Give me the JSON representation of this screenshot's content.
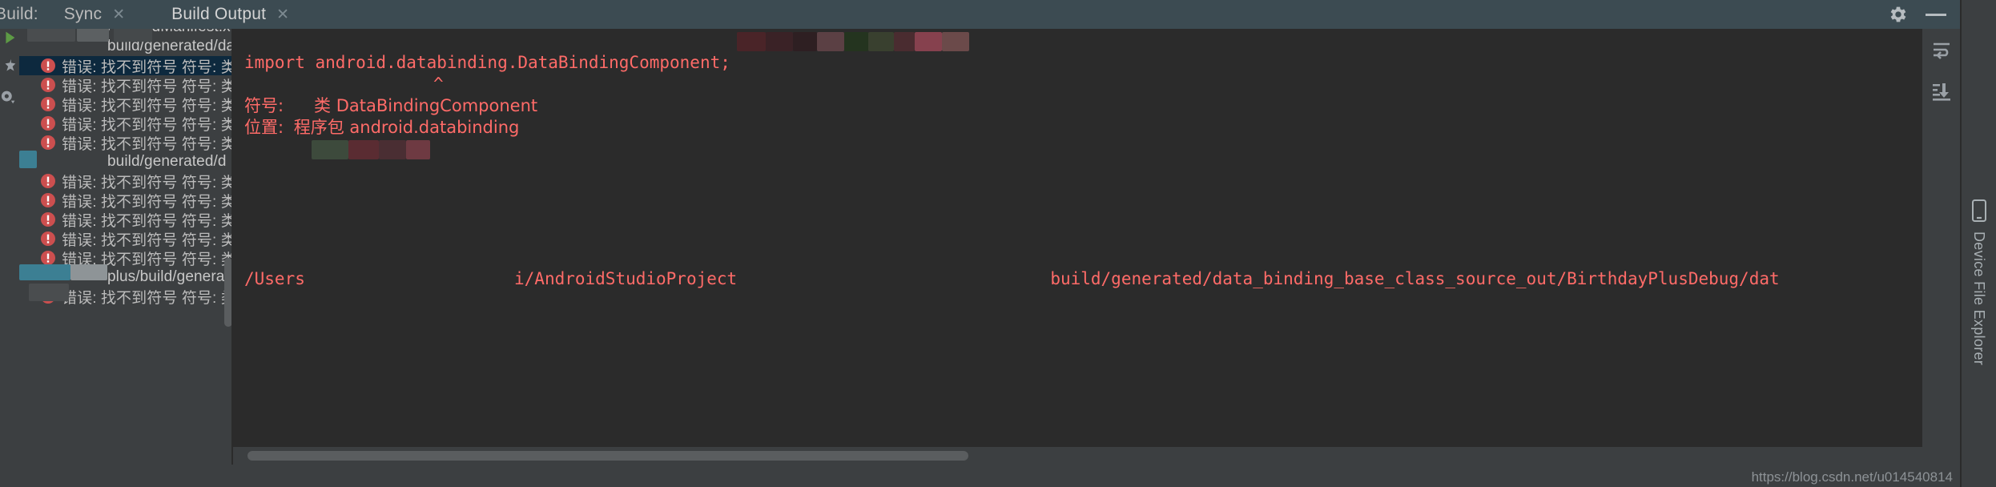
{
  "window": {
    "title_prefix": "Build:",
    "accent_blue": "#4a88c7",
    "error_red": "#e05555",
    "code_text_red": "#ff6b68",
    "panel_bg": "#3c3f41",
    "editor_bg": "#2b2b2b",
    "selection_bg": "#0d293e"
  },
  "header": {
    "label": "Build:",
    "tabs": [
      {
        "label": "Sync",
        "close": "✕",
        "active": false
      },
      {
        "label": "Build Output",
        "close": "✕",
        "active": true
      }
    ],
    "actions": [
      {
        "name": "settings-gear",
        "label": "Settings"
      },
      {
        "name": "minimize",
        "label": "Minimize"
      }
    ]
  },
  "left_strip": {
    "icons": [
      {
        "name": "run-icon",
        "label": "Run"
      },
      {
        "name": "pin-icon",
        "label": "Pin Tab"
      },
      {
        "name": "filter-icon",
        "label": "Filter"
      }
    ]
  },
  "tree": {
    "rows": [
      {
        "type": "group",
        "text": "AndroidManifest.xml",
        "redacted": true,
        "selected": false,
        "partial": true
      },
      {
        "type": "group",
        "text": "build/generated/data",
        "selected": false
      },
      {
        "type": "error",
        "text": "错误: 找不到符号 符号: 类",
        "selected": true
      },
      {
        "type": "error",
        "text": "错误: 找不到符号 符号: 类",
        "selected": false
      },
      {
        "type": "error",
        "text": "错误: 找不到符号 符号: 类",
        "selected": false
      },
      {
        "type": "error",
        "text": "错误: 找不到符号 符号: 类",
        "selected": false
      },
      {
        "type": "error",
        "text": "错误: 找不到符号 符号: 类",
        "selected": false
      },
      {
        "type": "group",
        "text": "build/generated/d",
        "selected": false
      },
      {
        "type": "error",
        "text": "错误: 找不到符号 符号: 类",
        "selected": false
      },
      {
        "type": "error",
        "text": "错误: 找不到符号 符号: 类",
        "selected": false
      },
      {
        "type": "error",
        "text": "错误: 找不到符号 符号: 类",
        "selected": false
      },
      {
        "type": "error",
        "text": "错误: 找不到符号 符号: 类",
        "selected": false
      },
      {
        "type": "error",
        "text": "错误: 找不到符号 符号: 类",
        "selected": false
      },
      {
        "type": "group",
        "text": "plus/build/generated/d",
        "selected": false
      },
      {
        "type": "error",
        "text": "错误: 找不到符号 符号: 类",
        "selected": false
      }
    ]
  },
  "code": {
    "path_prefix": "/Users",
    "path_mid": "i/AndroidStudioProject",
    "path_suffix": "build/generated/data_binding_base_class_source_out/BirthdayPlusDebug/dat",
    "line_import": "import android.databinding.DataBindingComponent;",
    "caret": "^",
    "symbol_label": "符号:",
    "symbol_value": "类 DataBindingComponent",
    "location_label": "位置:",
    "location_value": "程序包 android.databinding"
  },
  "right_strip": {
    "icons": [
      {
        "name": "soft-wrap-icon",
        "label": "Soft-Wrap"
      },
      {
        "name": "scroll-to-end-icon",
        "label": "Scroll to End"
      }
    ]
  },
  "far_strip": {
    "tool_window": {
      "name": "device-file-explorer",
      "label": "Device File Explorer"
    }
  },
  "watermark": {
    "text": "https://blog.csdn.net/u014540814"
  }
}
